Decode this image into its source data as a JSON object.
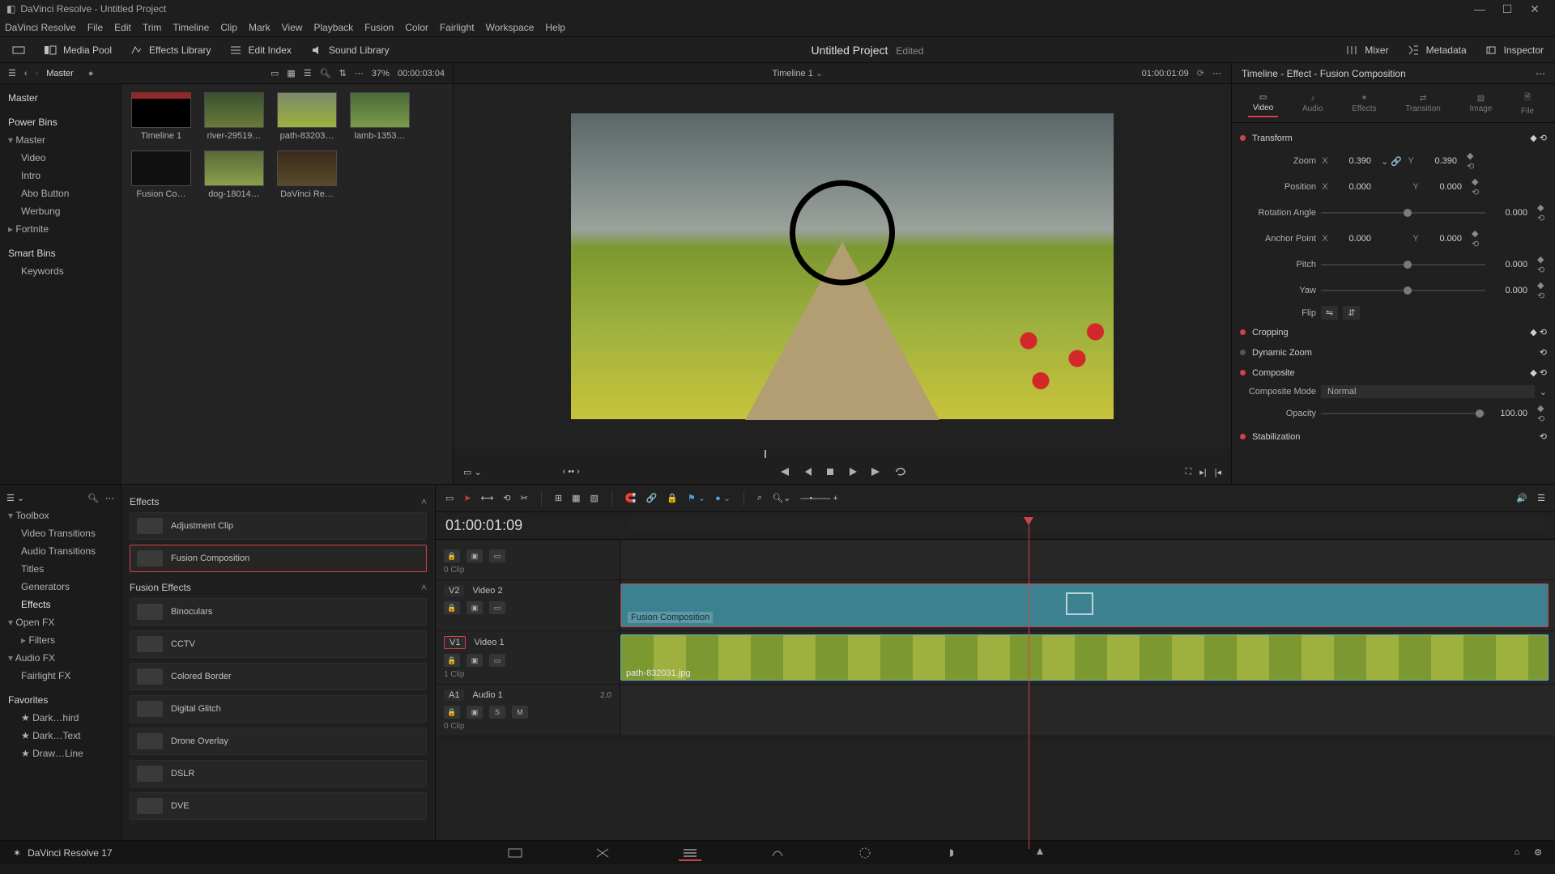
{
  "titlebar": {
    "text": "DaVinci Resolve - Untitled Project"
  },
  "menubar": [
    "DaVinci Resolve",
    "File",
    "Edit",
    "Trim",
    "Timeline",
    "Clip",
    "Mark",
    "View",
    "Playback",
    "Fusion",
    "Color",
    "Fairlight",
    "Workspace",
    "Help"
  ],
  "topbar": {
    "media_pool": "Media Pool",
    "effects_library": "Effects Library",
    "edit_index": "Edit Index",
    "sound_library": "Sound Library",
    "project": "Untitled Project",
    "edited": "Edited",
    "mixer": "Mixer",
    "metadata": "Metadata",
    "inspector": "Inspector"
  },
  "media": {
    "master": "Master",
    "zoom_pct": "37%",
    "src_tc": "00:00:03:04",
    "tree": {
      "master": "Master",
      "power_bins": "Power Bins",
      "pb_master": "Master",
      "items": [
        "Video",
        "Intro",
        "Abo Button",
        "Werbung",
        "Fortnite"
      ],
      "smart_bins": "Smart Bins",
      "keywords": "Keywords"
    },
    "clips": [
      "Timeline 1",
      "river-29519…",
      "path-83203…",
      "lamb-1353…",
      "Fusion Co…",
      "dog-18014…",
      "DaVinci Re…"
    ]
  },
  "viewer": {
    "title": "Timeline 1",
    "timecode": "01:00:01:09"
  },
  "inspector": {
    "title": "Timeline - Effect - Fusion Composition",
    "tabs": [
      "Video",
      "Audio",
      "Effects",
      "Transition",
      "Image",
      "File"
    ],
    "transform": {
      "label": "Transform",
      "zoom": "Zoom",
      "zoom_x": "0.390",
      "zoom_y": "0.390",
      "position": "Position",
      "pos_x": "0.000",
      "pos_y": "0.000",
      "rotation": "Rotation Angle",
      "rot_v": "0.000",
      "anchor": "Anchor Point",
      "anc_x": "0.000",
      "anc_y": "0.000",
      "pitch": "Pitch",
      "pitch_v": "0.000",
      "yaw": "Yaw",
      "yaw_v": "0.000",
      "flip": "Flip"
    },
    "cropping": "Cropping",
    "dynamic_zoom": "Dynamic Zoom",
    "composite": "Composite",
    "composite_mode_lbl": "Composite Mode",
    "composite_mode": "Normal",
    "opacity_lbl": "Opacity",
    "opacity": "100.00",
    "stabilization": "Stabilization"
  },
  "fxtree": {
    "toolbox": "Toolbox",
    "items": [
      "Video Transitions",
      "Audio Transitions",
      "Titles",
      "Generators",
      "Effects"
    ],
    "openfx": "Open FX",
    "filters": "Filters",
    "audiofx": "Audio FX",
    "fairlight": "Fairlight FX",
    "favorites": "Favorites",
    "favs": [
      "Dark…hird",
      "Dark…Text",
      "Draw…Line"
    ]
  },
  "fxlist": {
    "effects": "Effects",
    "adj": "Adjustment Clip",
    "fusion": "Fusion Composition",
    "fusion_effects": "Fusion Effects",
    "items": [
      "Binoculars",
      "CCTV",
      "Colored Border",
      "Digital Glitch",
      "Drone Overlay",
      "DSLR",
      "DVE"
    ]
  },
  "timeline": {
    "tc": "01:00:01:09",
    "v2": {
      "id": "V2",
      "name": "Video 2",
      "clipname": "Fusion Composition"
    },
    "v1": {
      "id": "V1",
      "name": "Video 1",
      "clip_count": "1 Clip",
      "clipname": "path-832031.jpg"
    },
    "a1": {
      "id": "A1",
      "name": "Audio 1",
      "ch": "2.0",
      "clip_count": "0 Clip"
    },
    "top_count": "0 Clip"
  },
  "footer": {
    "version": "DaVinci Resolve 17"
  }
}
